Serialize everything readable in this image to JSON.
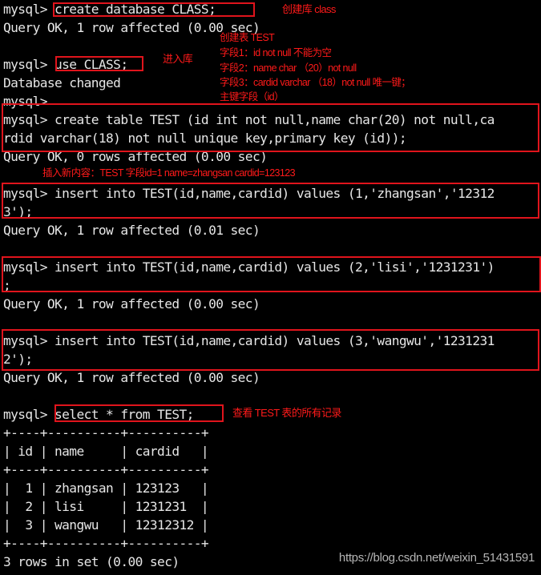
{
  "terminal": {
    "lines": [
      "mysql> create database CLASS;",
      "Query OK, 1 row affected (0.00 sec)",
      "",
      "mysql> use CLASS;",
      "Database changed",
      "mysql>",
      "mysql> create table TEST (id int not null,name char(20) not null,ca",
      "rdid varchar(18) not null unique key,primary key (id));",
      "Query OK, 0 rows affected (0.00 sec)",
      "",
      "mysql> insert into TEST(id,name,cardid) values (1,'zhangsan','12312",
      "3');",
      "Query OK, 1 row affected (0.01 sec)",
      "",
      "mysql> insert into TEST(id,name,cardid) values (2,'lisi','1231231')",
      ";",
      "Query OK, 1 row affected (0.00 sec)",
      "",
      "mysql> insert into TEST(id,name,cardid) values (3,'wangwu','1231231",
      "2');",
      "Query OK, 1 row affected (0.00 sec)",
      "",
      "mysql> select * from TEST;",
      "+----+----------+----------+",
      "| id | name     | cardid   |",
      "+----+----------+----------+",
      "|  1 | zhangsan | 123123   |",
      "|  2 | lisi     | 1231231  |",
      "|  3 | wangwu   | 12312312 |",
      "+----+----------+----------+",
      "3 rows in set (0.00 sec)"
    ]
  },
  "result_table": {
    "columns": [
      "id",
      "name",
      "cardid"
    ],
    "rows": [
      [
        "1",
        "zhangsan",
        "123123"
      ],
      [
        "2",
        "lisi",
        "1231231"
      ],
      [
        "3",
        "wangwu",
        "12312312"
      ]
    ],
    "summary": "3 rows in set (0.00 sec)"
  },
  "annotations": {
    "create_db": "创建库 class",
    "use_db": "进入库",
    "create_table": [
      "创建表 TEST",
      "字段1：id not null 不能为空",
      "字段2：name char （20）not null",
      "字段3：cardid varchar （18）not null 唯一键；",
      "主键字段（id）"
    ],
    "insert": "插入新内容：TEST 字段id=1 name=zhangsan cardid=123123",
    "select": "查看 TEST 表的所有记录"
  },
  "colors": {
    "background": "#000000",
    "text": "#e6e6e6",
    "highlight": "#e0141c",
    "annotation": "#ff1a1a"
  },
  "watermark": "https://blog.csdn.net/weixin_51431591"
}
